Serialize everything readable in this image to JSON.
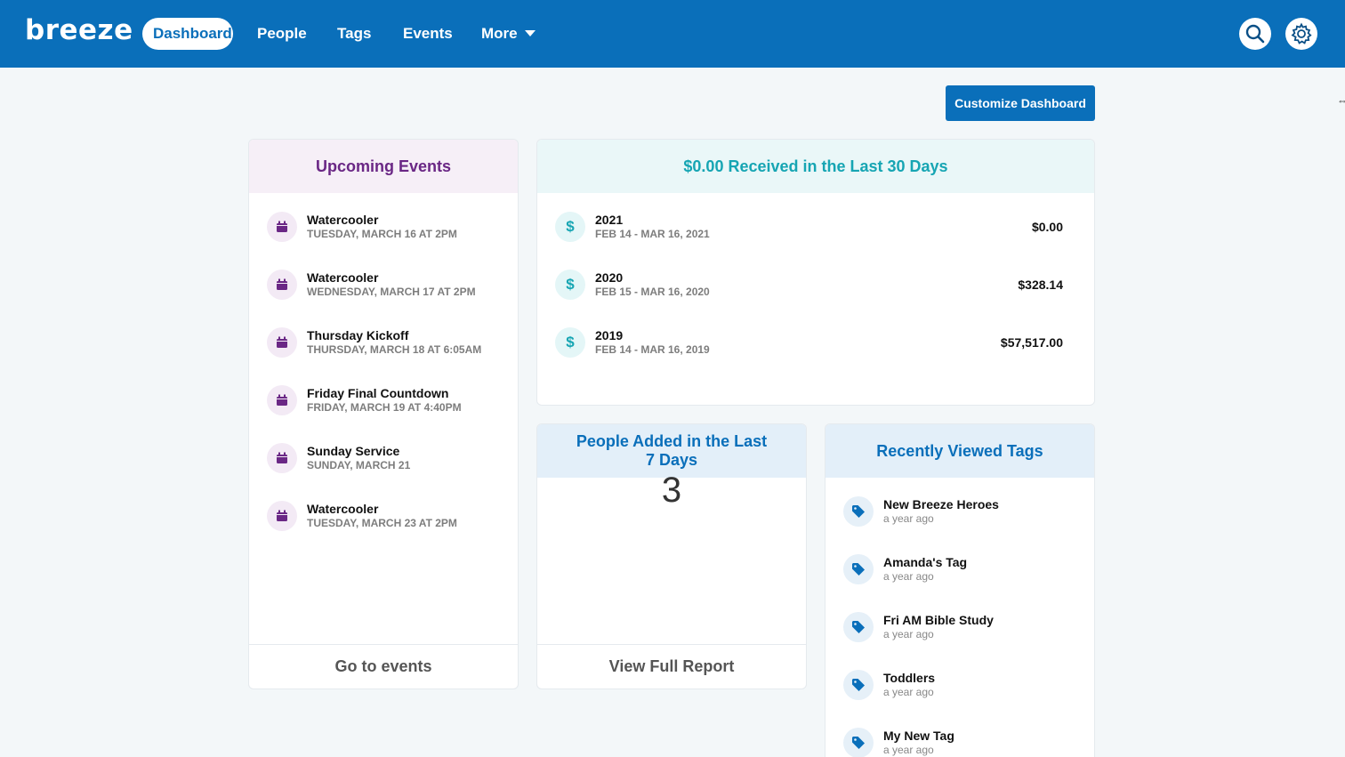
{
  "brand": {
    "logo_text": "breeze",
    "primary_color": "#0a6fba"
  },
  "nav": {
    "items": [
      {
        "label": "Dashboard",
        "active": true
      },
      {
        "label": "People"
      },
      {
        "label": "Tags"
      },
      {
        "label": "Events"
      },
      {
        "label": "More"
      }
    ],
    "search_icon": "search-icon",
    "settings_icon": "gear-icon"
  },
  "customize_button": {
    "label": "Customize Dashboard"
  },
  "upcoming_events": {
    "title": "Upcoming Events",
    "footer": "Go to events",
    "items": [
      {
        "name": "Watercooler",
        "when": "TUESDAY, MARCH 16 AT 2PM"
      },
      {
        "name": "Watercooler",
        "when": "WEDNESDAY, MARCH 17 AT 2PM"
      },
      {
        "name": "Thursday Kickoff",
        "when": "THURSDAY, MARCH 18 AT 6:05AM"
      },
      {
        "name": "Friday Final Countdown",
        "when": "FRIDAY, MARCH 19 AT 4:40PM"
      },
      {
        "name": "Sunday Service",
        "when": "SUNDAY, MARCH 21"
      },
      {
        "name": "Watercooler",
        "when": "TUESDAY, MARCH 23 AT 2PM"
      }
    ]
  },
  "giving": {
    "title": "$0.00 Received in the Last 30 Days",
    "rows": [
      {
        "year": "2021",
        "range": "FEB 14 - MAR 16, 2021",
        "amount": "$0.00"
      },
      {
        "year": "2020",
        "range": "FEB 15 - MAR 16, 2020",
        "amount": "$328.14"
      },
      {
        "year": "2019",
        "range": "FEB 14 - MAR 16, 2019",
        "amount": "$57,517.00"
      }
    ]
  },
  "people_added": {
    "title": "People Added in the Last 7 Days",
    "count": "3",
    "footer": "View Full Report"
  },
  "recent_tags": {
    "title": "Recently Viewed Tags",
    "items": [
      {
        "name": "New Breeze Heroes",
        "when": "a year ago"
      },
      {
        "name": "Amanda's Tag",
        "when": "a year ago"
      },
      {
        "name": "Fri AM Bible Study",
        "when": "a year ago"
      },
      {
        "name": "Toddlers",
        "when": "a year ago"
      },
      {
        "name": "My New Tag",
        "when": "a year ago"
      }
    ]
  }
}
